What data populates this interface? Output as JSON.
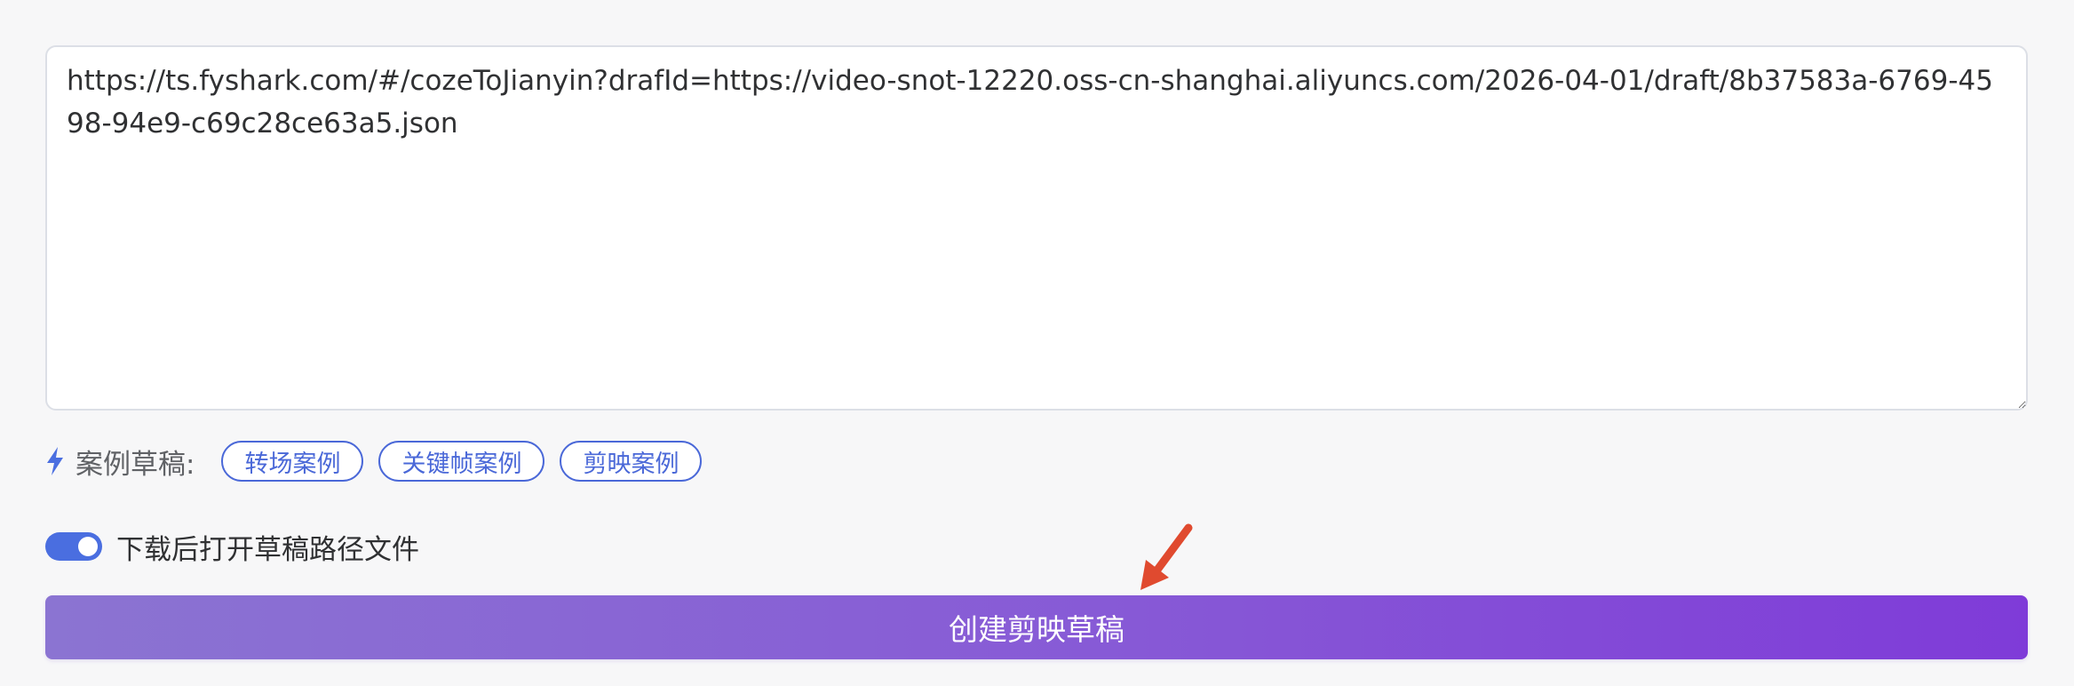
{
  "draft_input": {
    "value": "https://ts.fyshark.com/#/cozeToJianyin?drafId=https://video-snot-12220.oss-cn-shanghai.aliyuncs.com/2026-04-01/draft/8b37583a-6769-4598-94e9-c69c28ce63a5.json"
  },
  "samples": {
    "label": "案例草稿:",
    "icon": "lightning-bolt-icon",
    "items": [
      {
        "label": "转场案例"
      },
      {
        "label": "关键帧案例"
      },
      {
        "label": "剪映案例"
      }
    ]
  },
  "open_after_download": {
    "label": "下载后打开草稿路径文件",
    "enabled": true
  },
  "create_button": {
    "label": "创建剪映草稿"
  },
  "colors": {
    "accent": "#4a6ee0",
    "tag_text": "#4a68d8",
    "button_gradient_start": "#8b74d2",
    "button_gradient_end": "#7f3bd8",
    "arrow": "#e04a2f"
  }
}
